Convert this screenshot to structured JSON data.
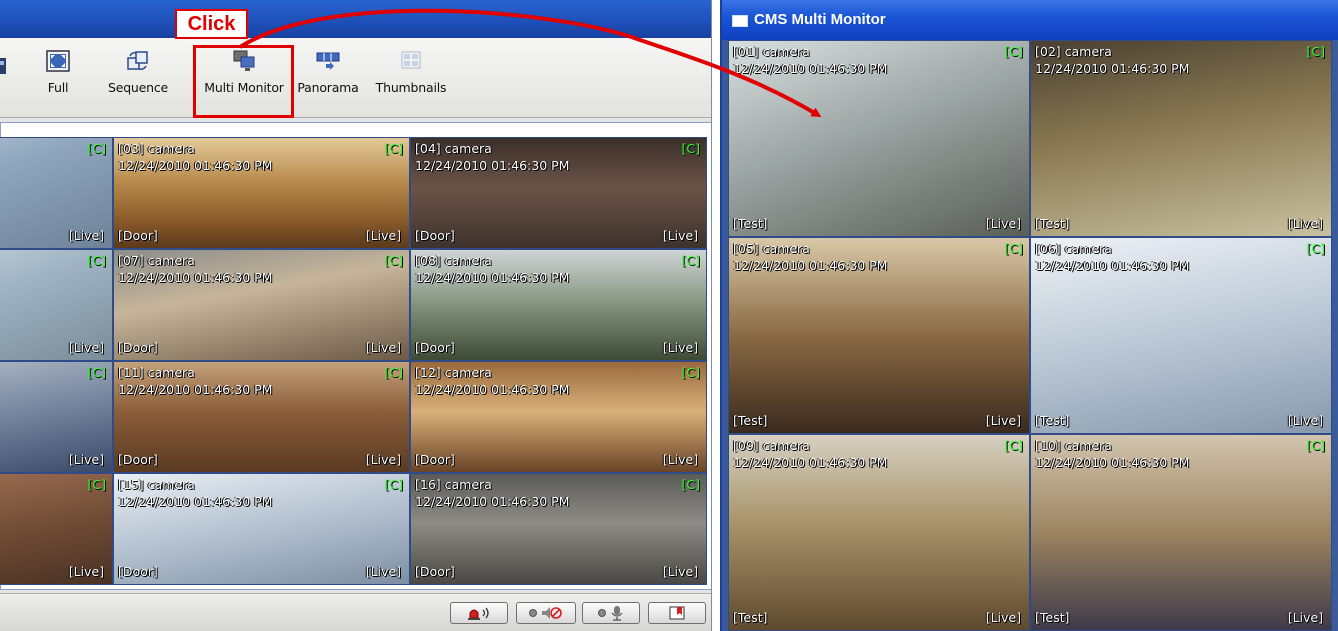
{
  "annotation": {
    "click_label": "Click",
    "color": "#e00000"
  },
  "toolbar": {
    "buttons": [
      {
        "label": "Full",
        "icon": "fullscreen-icon"
      },
      {
        "label": "Sequence",
        "icon": "sequence-icon"
      },
      {
        "label": "Multi Monitor",
        "icon": "multi-monitor-icon"
      },
      {
        "label": "Panorama",
        "icon": "panorama-icon"
      },
      {
        "label": "Thumbnails",
        "icon": "thumbnails-icon"
      }
    ]
  },
  "left_grid": {
    "tiles": [
      {
        "name": "",
        "time": "",
        "flag": "[C]",
        "group": "",
        "mode": "[Live]"
      },
      {
        "name": "[03] camera",
        "time": "12/24/2010 01:46:30 PM",
        "flag": "[C]",
        "group": "[Door]",
        "mode": "[Live]"
      },
      {
        "name": "[04] camera",
        "time": "12/24/2010 01:46:30 PM",
        "flag": "[C]",
        "group": "[Door]",
        "mode": "[Live]"
      },
      {
        "name": "",
        "time": "",
        "flag": "[C]",
        "group": "",
        "mode": "[Live]"
      },
      {
        "name": "[07] camera",
        "time": "12/24/2010 01:46:30 PM",
        "flag": "[C]",
        "group": "[Door]",
        "mode": "[Live]"
      },
      {
        "name": "[08] camera",
        "time": "12/24/2010 01:46:30 PM",
        "flag": "[C]",
        "group": "[Door]",
        "mode": "[Live]"
      },
      {
        "name": "",
        "time": "",
        "flag": "[C]",
        "group": "",
        "mode": "[Live]"
      },
      {
        "name": "[11] camera",
        "time": "12/24/2010 01:46:30 PM",
        "flag": "[C]",
        "group": "[Door]",
        "mode": "[Live]"
      },
      {
        "name": "[12] camera",
        "time": "12/24/2010 01:46:30 PM",
        "flag": "[C]",
        "group": "[Door]",
        "mode": "[Live]"
      },
      {
        "name": "",
        "time": "",
        "flag": "[C]",
        "group": "",
        "mode": "[Live]"
      },
      {
        "name": "[15] camera",
        "time": "12/24/2010 01:46:30 PM",
        "flag": "[C]",
        "group": "[Door]",
        "mode": "[Live]"
      },
      {
        "name": "[16] camera",
        "time": "12/24/2010 01:46:30 PM",
        "flag": "[C]",
        "group": "[Door]",
        "mode": "[Live]"
      }
    ]
  },
  "bottom_bar": {
    "buttons": [
      {
        "icon": "alarm-siren-icon"
      },
      {
        "icon": "speaker-mute-icon"
      },
      {
        "icon": "microphone-icon"
      },
      {
        "icon": "bookmark-icon"
      }
    ]
  },
  "multi_monitor": {
    "title": "CMS Multi Monitor",
    "tiles": [
      {
        "name": "[01] camera",
        "time": "12/24/2010 01:46:30 PM",
        "flag": "[C]",
        "group": "[Test]",
        "mode": "[Live]"
      },
      {
        "name": "[02] camera",
        "time": "12/24/2010 01:46:30 PM",
        "flag": "[C]",
        "group": "[Test]",
        "mode": "[Live]"
      },
      {
        "name": "[05] camera",
        "time": "12/24/2010 01:46:30 PM",
        "flag": "[C]",
        "group": "[Test]",
        "mode": "[Live]"
      },
      {
        "name": "[06] camera",
        "time": "12/24/2010 01:46:30 PM",
        "flag": "[C]",
        "group": "[Test]",
        "mode": "[Live]"
      },
      {
        "name": "[09] camera",
        "time": "12/24/2010 01:46:30 PM",
        "flag": "[C]",
        "group": "[Test]",
        "mode": "[Live]"
      },
      {
        "name": "[10] camera",
        "time": "12/24/2010 01:46:30 PM",
        "flag": "[C]",
        "group": "[Test]",
        "mode": "[Live]"
      }
    ]
  }
}
